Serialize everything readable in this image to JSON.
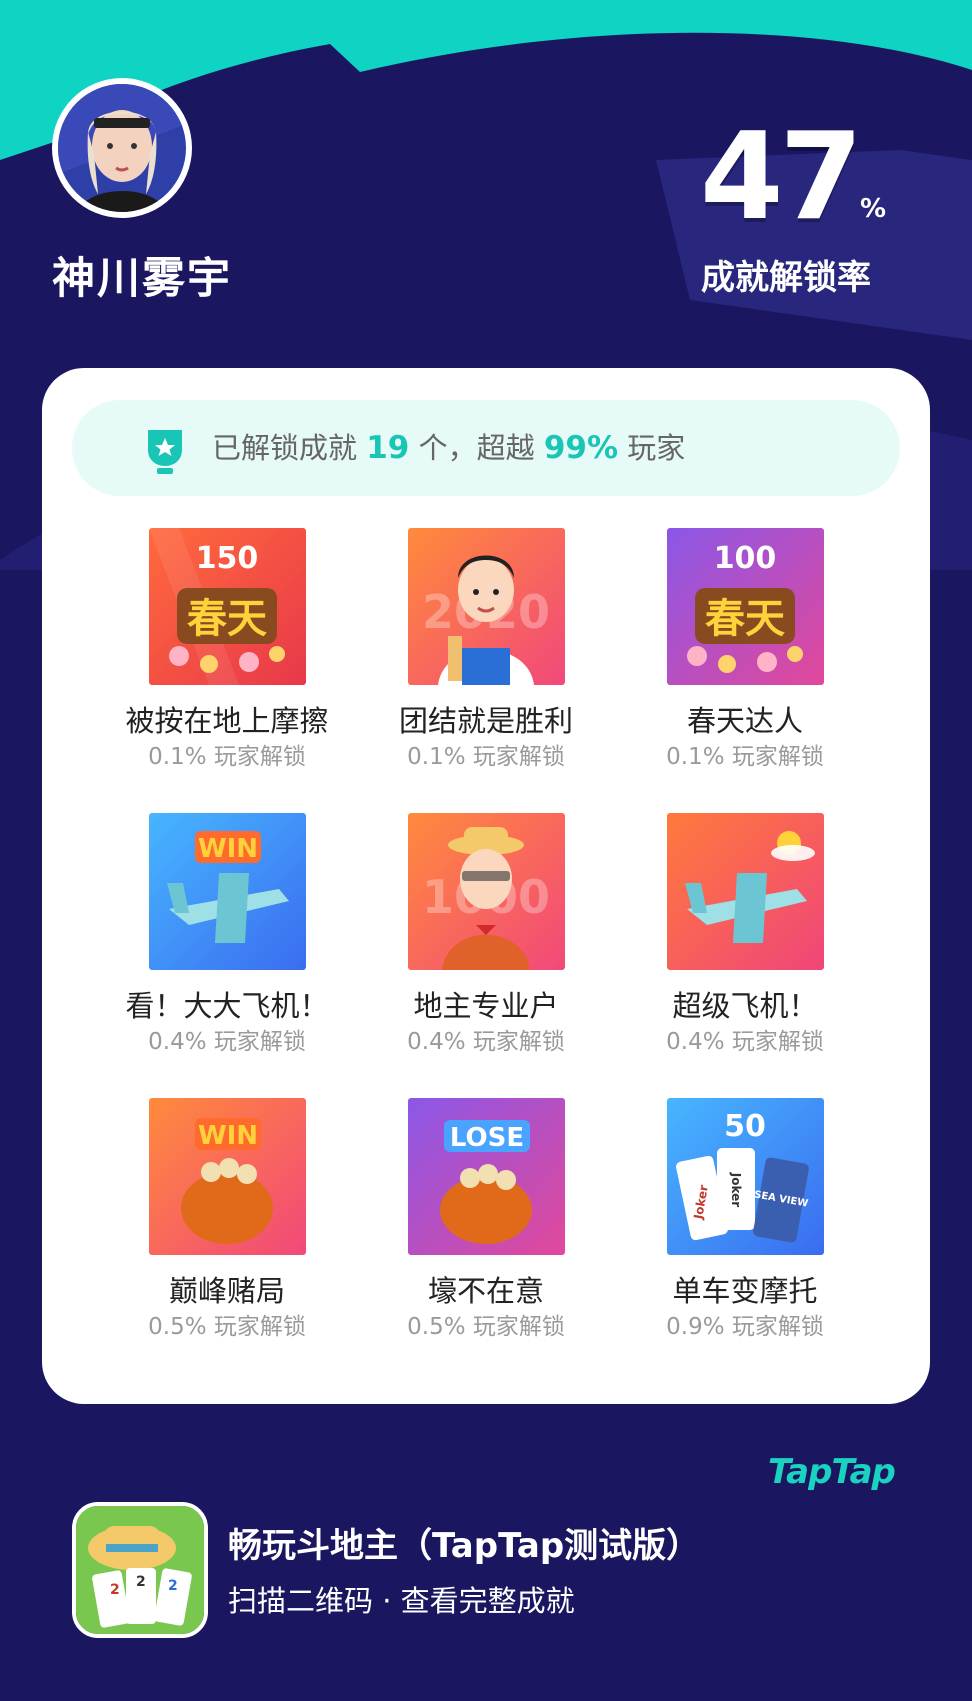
{
  "user": {
    "name": "神川雾宇"
  },
  "stats": {
    "rate_value": "47",
    "rate_unit": "%",
    "rate_label": "成就解锁率"
  },
  "summary": {
    "prefix": "已解锁成就",
    "count": "19",
    "count_unit": "个，超越",
    "percent": "99%",
    "suffix": "玩家"
  },
  "achievements": [
    {
      "name": "被按在地上摩擦",
      "percent": "0.1% 玩家解锁",
      "badge_number": "150",
      "badge_text": "春天",
      "icon": "spring-150-badge-icon"
    },
    {
      "name": "团结就是胜利",
      "percent": "0.1% 玩家解锁",
      "badge_number": "2020",
      "icon": "farmer-boy-badge-icon"
    },
    {
      "name": "春天达人",
      "percent": "0.1% 玩家解锁",
      "badge_number": "100",
      "badge_text": "春天",
      "icon": "spring-100-badge-icon"
    },
    {
      "name": "看！大大飞机！",
      "percent": "0.4% 玩家解锁",
      "badge_text": "WIN",
      "icon": "airplane-win-badge-icon"
    },
    {
      "name": "地主专业户",
      "percent": "0.4% 玩家解锁",
      "badge_number": "1000",
      "icon": "landlord-badge-icon"
    },
    {
      "name": "超级飞机！",
      "percent": "0.4% 玩家解锁",
      "icon": "super-airplane-badge-icon"
    },
    {
      "name": "巅峰赌局",
      "percent": "0.5% 玩家解锁",
      "badge_text": "WIN",
      "icon": "money-bag-win-badge-icon"
    },
    {
      "name": "壕不在意",
      "percent": "0.5% 玩家解锁",
      "badge_text": "LOSE",
      "icon": "money-bag-lose-badge-icon"
    },
    {
      "name": "单车变摩托",
      "percent": "0.9% 玩家解锁",
      "badge_number": "50",
      "badge_cards": [
        "Joker",
        "Joker",
        "SEA VIEW"
      ],
      "icon": "cards-50-badge-icon"
    }
  ],
  "footer": {
    "brand": "TapTap",
    "app_name": "畅玩斗地主（TapTap测试版）",
    "app_sub": "扫描二维码 · 查看完整成就"
  },
  "colors": {
    "background": "#1a1660",
    "accent": "#19d3c0",
    "card": "#ffffff",
    "summary_bg": "#e6faf7"
  }
}
